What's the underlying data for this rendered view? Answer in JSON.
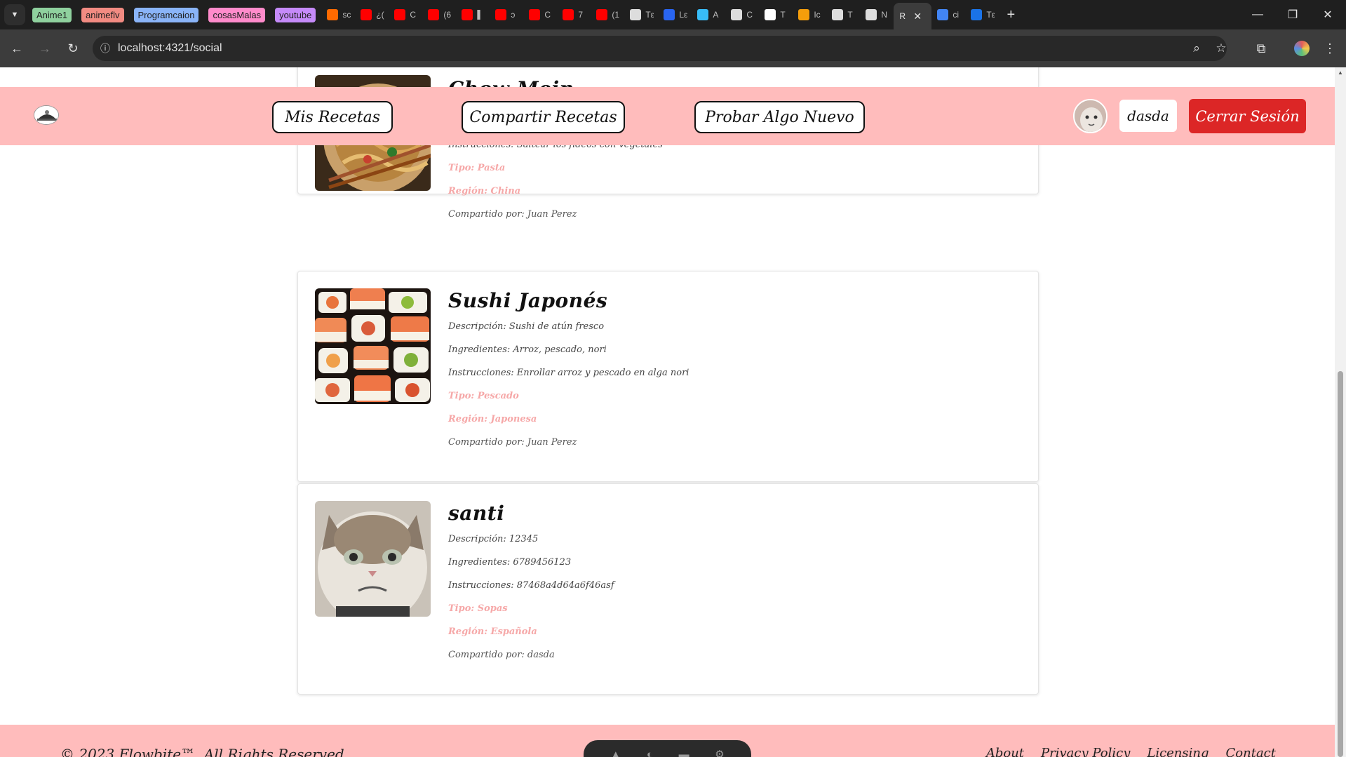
{
  "browser": {
    "bookmarks": [
      {
        "label": "Anime1",
        "color": "#8fd19e"
      },
      {
        "label": "animeflv",
        "color": "#f28b82"
      },
      {
        "label": "Programcaion",
        "color": "#8ab4f8"
      },
      {
        "label": "cosasMalas",
        "color": "#ff8bcb"
      },
      {
        "label": "youtube",
        "color": "#c58af9"
      }
    ],
    "tabs": [
      {
        "label": "sc",
        "color": "#ff6a00",
        "icon": "w-logo-icon"
      },
      {
        "label": "¿(",
        "color": "#ff0000",
        "icon": "youtube-icon"
      },
      {
        "label": "C",
        "color": "#ff0000",
        "icon": "youtube-icon"
      },
      {
        "label": "(6",
        "color": "#ff0000",
        "icon": "youtube-icon"
      },
      {
        "label": "▌",
        "color": "#ff0000",
        "icon": "youtube-icon"
      },
      {
        "label": "ↄ",
        "color": "#ff0000",
        "icon": "youtube-icon"
      },
      {
        "label": "C",
        "color": "#ff0000",
        "icon": "youtube-icon"
      },
      {
        "label": "7",
        "color": "#ff0000",
        "icon": "youtube-icon"
      },
      {
        "label": "(1",
        "color": "#ff0000",
        "icon": "youtube-icon"
      },
      {
        "label": "Tε",
        "color": "#dddddd",
        "icon": "doc-icon"
      },
      {
        "label": "Lε",
        "color": "#2965f1",
        "icon": "css-icon"
      },
      {
        "label": "A",
        "color": "#38bdf8",
        "icon": "tailwind-icon"
      },
      {
        "label": "C",
        "color": "#dddddd",
        "icon": "vercel-icon"
      },
      {
        "label": "T",
        "color": "#ffffff",
        "icon": "github-icon"
      },
      {
        "label": "Ic",
        "color": "#f59e0b",
        "icon": "astro-icon"
      },
      {
        "label": "T",
        "color": "#dddddd",
        "icon": "openai-icon"
      },
      {
        "label": "N",
        "color": "#dddddd",
        "icon": "globe-icon"
      }
    ],
    "active_tab": {
      "label": "R"
    },
    "after_tabs": [
      {
        "label": "ci",
        "color": "#4285f4",
        "icon": "google-icon"
      },
      {
        "label": "Tε",
        "color": "#1a73e8",
        "icon": "blue-circle-icon"
      }
    ],
    "url": "localhost:4321/social"
  },
  "header": {
    "nav": [
      "Mis Recetas",
      "Compartir Recetas",
      "Probar Algo Nuevo"
    ],
    "username": "dasda",
    "logout_label": "Cerrar Sesión"
  },
  "recipes": [
    {
      "title": "Chow Mein",
      "visible_rows": [
        "Instrucciones: Saltear los fideos con vegetales",
        "Tipo: Pasta",
        "Región: China",
        "Compartido por: Juan Perez"
      ],
      "instrucciones": "Instrucciones: Saltear los fideos con vegetales",
      "tipo": "Tipo: Pasta",
      "region": "Región: China",
      "autor": "Compartido por: Juan Perez"
    },
    {
      "title": "Sushi Japonés",
      "descripcion": "Descripción: Sushi de atún fresco",
      "ingredientes": "Ingredientes: Arroz, pescado, nori",
      "instrucciones": "Instrucciones: Enrollar arroz y pescado en alga nori",
      "tipo": "Tipo: Pescado",
      "region": "Región: Japonesa",
      "autor": "Compartido por: Juan Perez"
    },
    {
      "title": "santi",
      "descripcion": "Descripción: 12345",
      "ingredientes": "Ingredientes: 6789456123",
      "instrucciones": "Instrucciones: 87468a4d64a6f46asf",
      "tipo": "Tipo: Sopas",
      "region": "Región: Española",
      "autor": "Compartido por: dasda"
    }
  ],
  "footer": {
    "copyright": "© 2023 Flowbite™. All Rights Reserved.",
    "links": [
      "About",
      "Privacy Policy",
      "Licensing",
      "Contact"
    ]
  }
}
